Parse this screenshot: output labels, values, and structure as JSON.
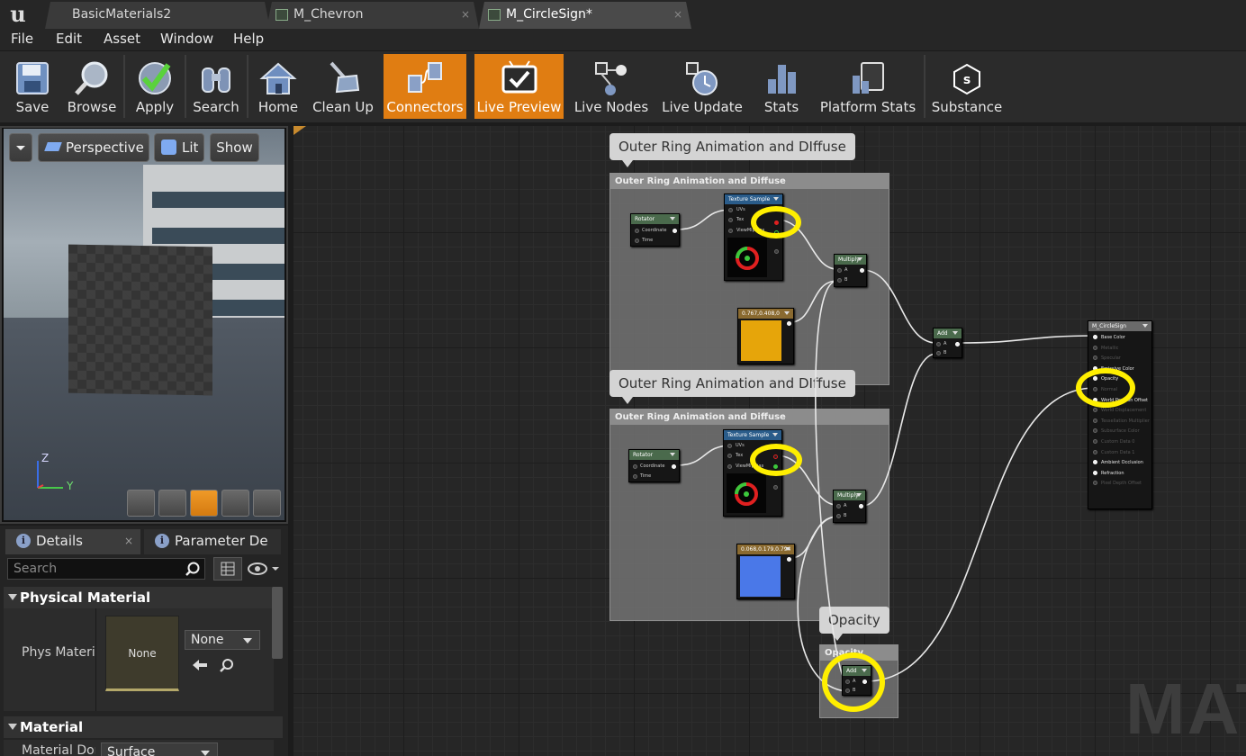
{
  "titlebar": {
    "tabs": [
      {
        "label": "BasicMaterials2"
      },
      {
        "label": "M_Chevron",
        "close": "×"
      },
      {
        "label": "M_CircleSign*",
        "close": "×"
      }
    ]
  },
  "menu": [
    "File",
    "Edit",
    "Asset",
    "Window",
    "Help"
  ],
  "toolbar": {
    "save": "Save",
    "browse": "Browse",
    "apply": "Apply",
    "search": "Search",
    "home": "Home",
    "clean_up": "Clean Up",
    "connectors": "Connectors",
    "live_preview": "Live Preview",
    "live_nodes": "Live Nodes",
    "live_update": "Live Update",
    "stats": "Stats",
    "platform_stats": "Platform Stats",
    "substance": "Substance"
  },
  "viewport": {
    "perspective": "Perspective",
    "lit": "Lit",
    "show": "Show",
    "axis_z": "Z",
    "axis_y": "Y"
  },
  "details": {
    "tab_details": "Details",
    "tab_params": "Parameter De",
    "search_placeholder": "Search",
    "section_physical": "Physical Material",
    "phys_label": "Phys Materia",
    "phys_thumb": "None",
    "phys_combo": "None",
    "section_material": "Material",
    "material_domain_label": "Material Don",
    "material_domain_value": "Surface"
  },
  "graph": {
    "comment_bubble_1": "Outer Ring Animation and DIffuse",
    "comment_box_1": "Outer Ring Animation and Diffuse",
    "comment_bubble_2": "Outer Ring Animation and DIffuse",
    "comment_box_2": "Outer Ring Animation and Diffuse",
    "comment_bubble_3": "Opacity",
    "comment_box_3": "Opacity",
    "watermark": "MAT",
    "rotator": "Rotator",
    "coordinate": "Coordinate",
    "time": "Time",
    "texture_sample": "Texture Sample",
    "uvs": "UVs",
    "tex": "Tex",
    "view_mip": "ViewMipBias",
    "multiply": "Multiply",
    "add": "Add",
    "pin_a": "A",
    "pin_b": "B",
    "const1_value": "0.767,0.408,0",
    "const2_value": "0.068,0.179,0.794",
    "const1_color": "#e6a50a",
    "const2_color": "#4a78e8",
    "result_node": "M_CircleSign",
    "result_pins": [
      "Base Color",
      "Metallic",
      "Specular",
      "Emissive Color",
      "Opacity",
      "Normal",
      "World Position Offset",
      "World Displacement",
      "Tessellation Multiplier",
      "Subsurface Color",
      "Custom Data 0",
      "Custom Data 1",
      "Ambient Occlusion",
      "Refraction",
      "Pixel Depth Offset"
    ]
  },
  "colors": {
    "accent": "#e07d12",
    "highlight": "#ffef00"
  }
}
